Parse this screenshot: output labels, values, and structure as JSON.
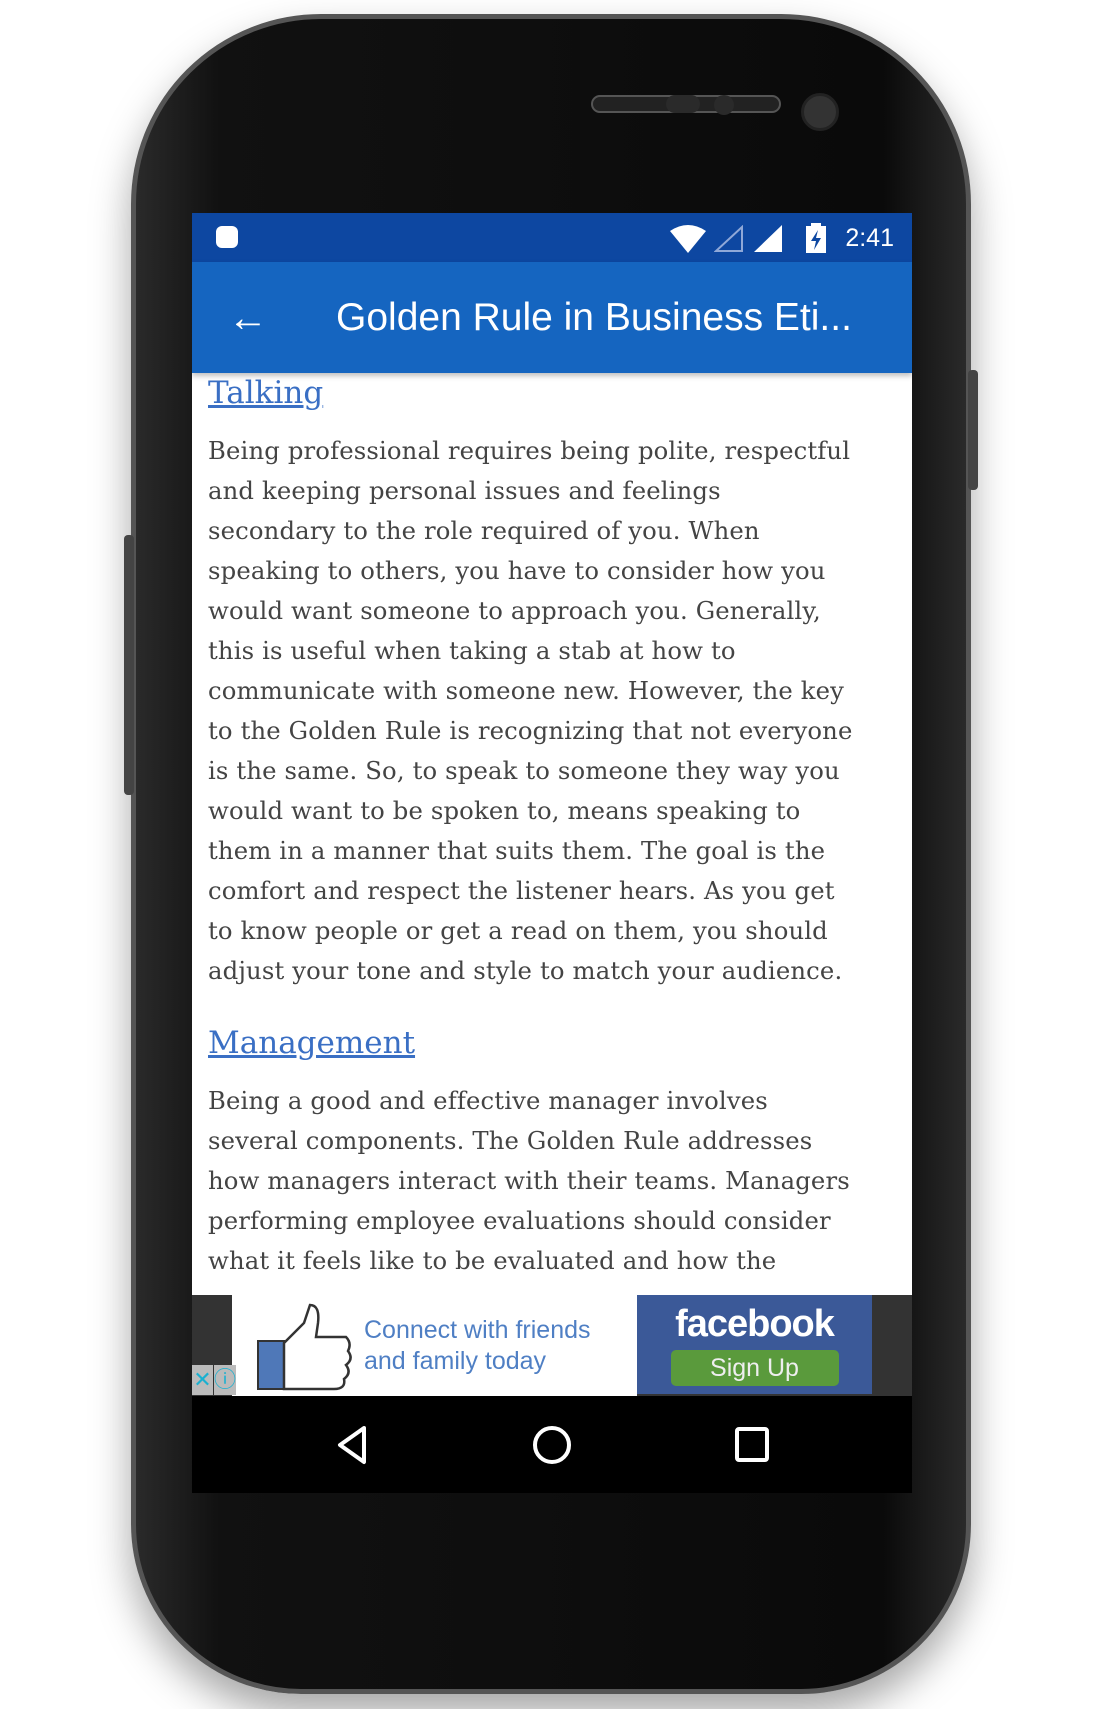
{
  "status_bar": {
    "time": "2:41",
    "icons": [
      "android-debug-icon",
      "wifi-icon",
      "signal-empty-icon",
      "signal-full-icon",
      "battery-charging-icon"
    ]
  },
  "app_bar": {
    "title": "Golden Rule in Business Eti...",
    "back_icon": "arrow-left-icon"
  },
  "sections": [
    {
      "heading": "Talking",
      "lines": [
        "Being professional requires being polite, respectful",
        "and keeping personal issues and feelings",
        "secondary to the role required of you. When",
        "speaking to others, you have to consider how you",
        "would want someone to approach you. Generally,",
        "this is useful when taking a stab at how to",
        "communicate with someone new. However, the key",
        "to the Golden Rule is recognizing that not everyone",
        "is the same. So, to speak to someone they way you",
        "would want to be spoken to, means speaking to",
        "them in a manner that suits them. The goal is the",
        "comfort and respect the listener hears. As you get",
        "to know people or get a read on them, you should",
        "adjust your tone and style to match your audience."
      ]
    },
    {
      "heading": "Management",
      "lines": [
        "Being a good and effective manager involves",
        "several components. The Golden Rule addresses",
        "how managers interact with their teams. Managers",
        "performing employee evaluations should consider",
        "what it feels like to be evaluated and how the"
      ]
    }
  ],
  "ad": {
    "line1": "Connect with friends",
    "line2": "and family today",
    "brand": "facebook",
    "cta": "Sign Up",
    "close": "✕",
    "info": "ⓘ"
  },
  "colors": {
    "status": "#0d47a1",
    "appbar": "#1565c0",
    "link": "#3a6fc4",
    "fb": "#3b5998",
    "cta": "#5a9a3c"
  }
}
